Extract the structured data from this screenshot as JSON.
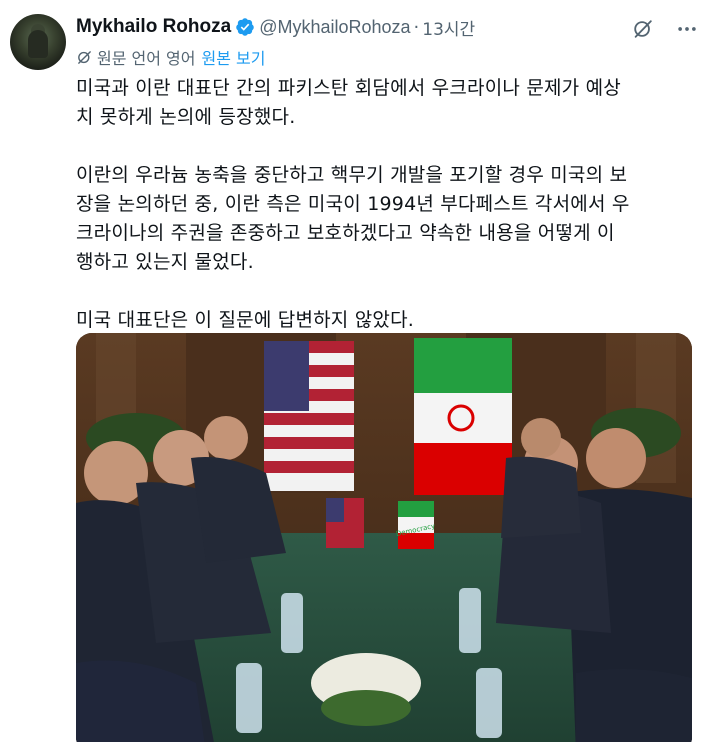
{
  "author": {
    "display_name": "Mykhailo Rohoza",
    "handle": "@MykhailoRohoza",
    "separator": "·",
    "time": "13시간",
    "verified_icon": "verified-badge-icon",
    "avatar_icon": "avatar"
  },
  "actions": {
    "grok_icon": "grok-icon",
    "more_icon": "more-icon"
  },
  "translation": {
    "icon": "translate-icon",
    "label": "원문 언어 영어",
    "show_original": "원본 보기"
  },
  "tweet": {
    "paragraphs": [
      "미국과 이란 대표단 간의 파키스탄 회담에서 우크라이나 문제가 예상\n치 못하게 논의에 등장했다.",
      "이란의 우라늄 농축을 중단하고 핵무기 개발을 포기할 경우 미국의 보\n장을 논의하던 중, 이란 측은 미국이 1994년 부다페스트 각서에서 우\n크라이나의 주권을 존중하고 보호하겠다고 약속한 내용을 어떻게 이\n행하고 있는지 물었다.",
      "미국 대표단은 이 질문에 답변하지 않았다."
    ]
  },
  "media": {
    "type": "photo",
    "flag_text": "Democracy"
  },
  "colors": {
    "text": "#0f1419",
    "secondary": "#536471",
    "link": "#1d9bf0",
    "verified": "#1d9bf0"
  }
}
